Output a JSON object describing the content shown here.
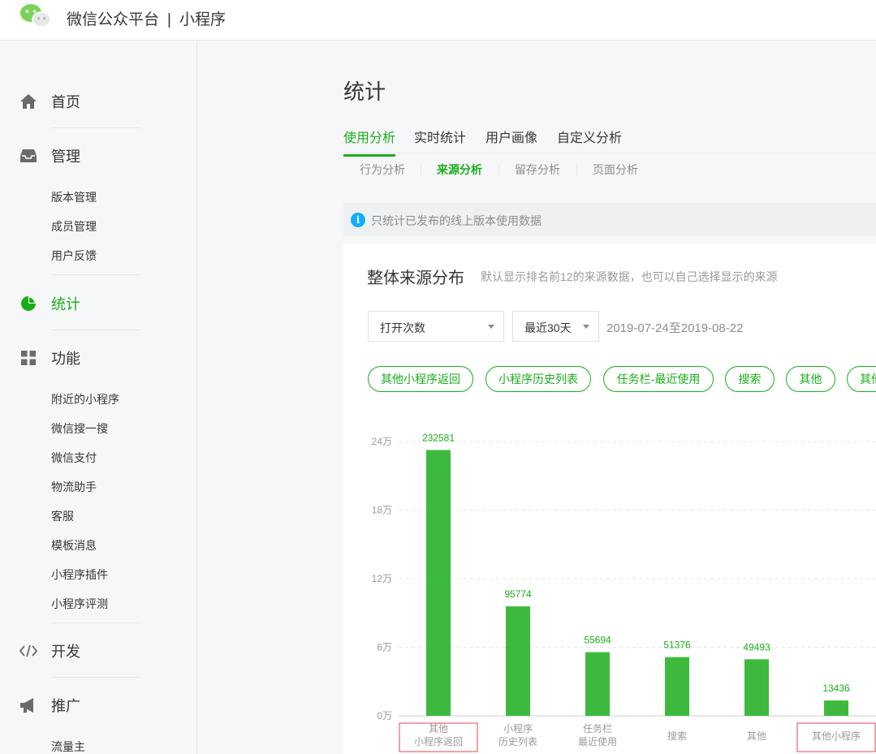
{
  "header": {
    "brand_name": "微信公众平台",
    "separator": "|",
    "product": "小程序"
  },
  "sidebar": {
    "home": "首页",
    "manage": "管理",
    "manage_items": [
      "版本管理",
      "成员管理",
      "用户反馈"
    ],
    "stats": "统计",
    "features": "功能",
    "feature_items": [
      "附近的小程序",
      "微信搜一搜",
      "微信支付",
      "物流助手",
      "客服",
      "模板消息",
      "小程序插件",
      "小程序评测"
    ],
    "develop": "开发",
    "promote": "推广",
    "promote_items": [
      "流量主"
    ]
  },
  "main": {
    "title": "统计",
    "tabs": [
      "使用分析",
      "实时统计",
      "用户画像",
      "自定义分析"
    ],
    "subtabs": [
      "行为分析",
      "来源分析",
      "留存分析",
      "页面分析"
    ],
    "notice": "只统计已发布的线上版本使用数据",
    "notice_icon": "i"
  },
  "card": {
    "title": "整体来源分布",
    "desc": "默认显示排名前12的来源数据，也可以自己选择显示的来源",
    "metric_select": "打开次数",
    "period_select": "最近30天",
    "date_range": "2019-07-24至2019-08-22",
    "source_pills": [
      "其他小程序返回",
      "小程序历史列表",
      "任务栏-最近使用",
      "搜索",
      "其他",
      "其他小程序"
    ],
    "source_pill_partial": "其他"
  },
  "colors": {
    "accent": "#1aad19",
    "bar": "#3dba3d",
    "highlight_box": "#e0474c"
  },
  "chart_data": {
    "type": "bar",
    "categories": [
      "其他\n小程序返回",
      "小程序\n历史列表",
      "任务栏\n最近使用",
      "搜索",
      "其他",
      "其他小程序"
    ],
    "values": [
      232581,
      95774,
      55694,
      51376,
      49493,
      13436
    ],
    "y_ticks": [
      "0万",
      "6万",
      "12万",
      "18万",
      "24万"
    ],
    "ylim": [
      0,
      240000
    ],
    "grid": true,
    "highlighted_categories": [
      0,
      5
    ]
  }
}
